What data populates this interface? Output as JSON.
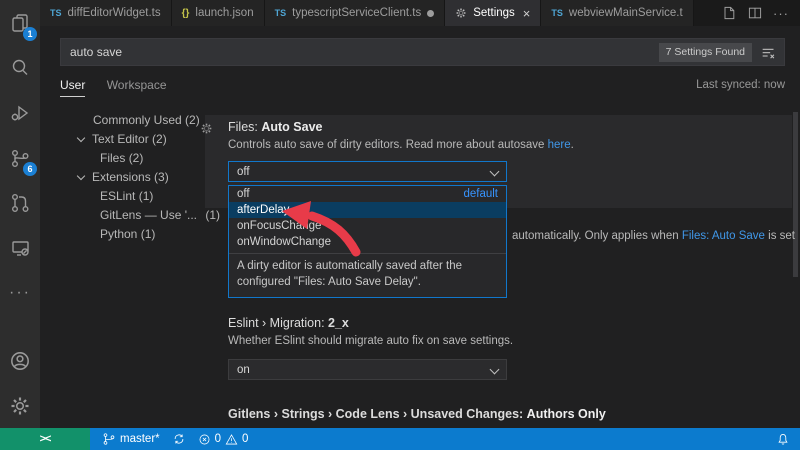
{
  "icons_text": {
    "ts": "TS",
    "json_braces": "{}",
    "close": "×",
    "more": "···",
    "remote": "><"
  },
  "activity_bar": {
    "explorer_badge": "1",
    "scm_badge": "6"
  },
  "tabs": {
    "items": [
      {
        "label": "diffEditorWidget.ts",
        "icon_text": "TS"
      },
      {
        "label": "launch.json",
        "icon_text": "{}"
      },
      {
        "label": "typescriptServiceClient.ts",
        "icon_text": "TS"
      },
      {
        "label": "Settings",
        "close": "×"
      },
      {
        "label": "webviewMainService.t",
        "icon_text": "TS"
      }
    ]
  },
  "search": {
    "value": "auto save",
    "results_badge": "7 Settings Found"
  },
  "scope": {
    "user": "User",
    "workspace": "Workspace",
    "last_synced": "Last synced: now"
  },
  "toc": {
    "items": [
      {
        "label": "Commonly Used",
        "count": "(2)"
      },
      {
        "label": "Text Editor",
        "count": "(2)"
      },
      {
        "label": "Files",
        "count": "(2)"
      },
      {
        "label": "Extensions",
        "count": "(3)"
      },
      {
        "label": "ESLint",
        "count": "(1)"
      },
      {
        "label": "GitLens — Use '...",
        "count": "(1)"
      },
      {
        "label": "Python",
        "count": "(1)"
      }
    ]
  },
  "setting_autosave": {
    "category": "Files: ",
    "name": "Auto Save",
    "desc_before": "Controls auto save of dirty editors. Read more about autosave ",
    "desc_link": "here",
    "desc_after": ".",
    "select_value": "off",
    "dropdown": {
      "options": [
        {
          "label": "off",
          "tag": "default"
        },
        {
          "label": "afterDelay"
        },
        {
          "label": "onFocusChange"
        },
        {
          "label": "onWindowChange"
        }
      ],
      "detail": "A dirty editor is automatically saved after the configured \"Files: Auto Save Delay\"."
    }
  },
  "setting_occluded": {
    "text_before": "automatically. Only applies when ",
    "link": "Files: Auto Save",
    "text_after": " is set"
  },
  "setting_eslint": {
    "title_prefix": "Eslint › Migration: ",
    "title_value": "2_x",
    "description": "Whether ESlint should migrate auto fix on save settings.",
    "select_value": "on"
  },
  "setting_gitlens": {
    "title_prefix": "Gitlens › Strings › Code Lens › Unsaved Changes: ",
    "title_value": "Authors Only"
  },
  "status_bar": {
    "branch": "master*",
    "errors": "0",
    "warnings": "0"
  },
  "colors": {
    "status_blue": "#0c7bce",
    "remote_green": "#12916a",
    "focus_border": "#1177cb",
    "link_blue": "#4097e8",
    "selected_option_bg": "#0a3d61",
    "annotation_arrow_red": "#e83b49",
    "badge_blue": "#1b80d4"
  }
}
